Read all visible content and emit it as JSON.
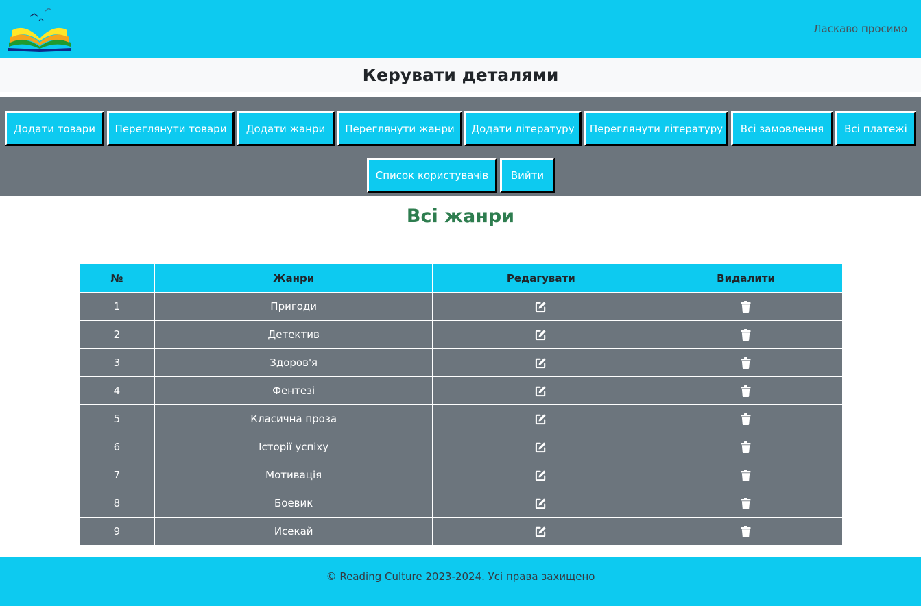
{
  "header": {
    "welcome_text": "Ласкаво просимо",
    "logo_icon": "open-book-logo"
  },
  "page": {
    "title": "Керувати деталями",
    "section_title": "Всі жанри"
  },
  "nav": {
    "add_products": "Додати товари",
    "view_products": "Переглянути товари",
    "add_genres": "Додати жанри",
    "view_genres": "Переглянути жанри",
    "add_literature": "Додати літературу",
    "view_literature": "Переглянути літературу",
    "all_orders": "Всі замовлення",
    "all_payments": "Всі платежі",
    "user_list": "Список користувачів",
    "logout": "Вийти"
  },
  "table": {
    "headers": {
      "number": "№",
      "genre": "Жанри",
      "edit": "Редагувати",
      "delete": "Видалити"
    },
    "edit_icon": "edit-icon",
    "delete_icon": "trash-icon",
    "rows": [
      {
        "number": "1",
        "genre": "Пригоди"
      },
      {
        "number": "2",
        "genre": "Детектив"
      },
      {
        "number": "3",
        "genre": "Здоров'я"
      },
      {
        "number": "4",
        "genre": "Фентезі"
      },
      {
        "number": "5",
        "genre": "Класична проза"
      },
      {
        "number": "6",
        "genre": "Історії успіху"
      },
      {
        "number": "7",
        "genre": "Мотивація"
      },
      {
        "number": "8",
        "genre": "Боевик"
      },
      {
        "number": "9",
        "genre": "Исекай"
      }
    ]
  },
  "footer": {
    "copyright": "© Reading Culture 2023-2024. Усі права захищено"
  },
  "colors": {
    "accent": "#0dcaf0",
    "nav_background": "#6c757d",
    "section_title": "#2e7d4f"
  }
}
